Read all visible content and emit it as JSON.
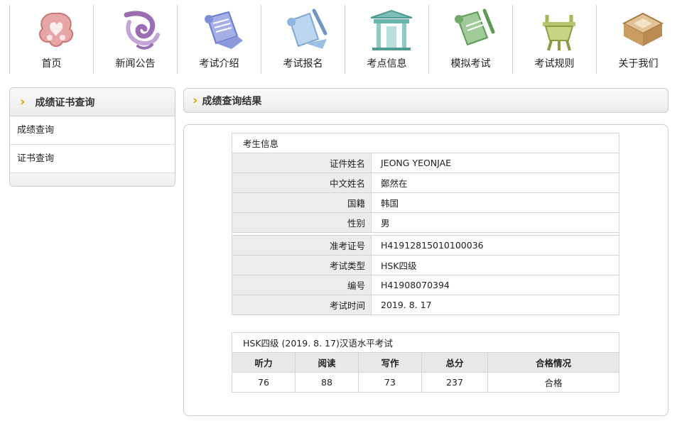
{
  "nav": [
    {
      "label": "首页",
      "icon": "home-cloud-icon",
      "color": "#d98f8f"
    },
    {
      "label": "新闻公告",
      "icon": "news-swirl-icon",
      "color": "#9a6db5"
    },
    {
      "label": "考试介绍",
      "icon": "exam-scroll-icon",
      "color": "#7f8fd6"
    },
    {
      "label": "考试报名",
      "icon": "register-scroll-icon",
      "color": "#8fb6df"
    },
    {
      "label": "考点信息",
      "icon": "test-center-gate-icon",
      "color": "#6ab5ad"
    },
    {
      "label": "模拟考试",
      "icon": "mock-exam-scroll-icon",
      "color": "#72a86a"
    },
    {
      "label": "考试规则",
      "icon": "rules-tripod-icon",
      "color": "#a4b55a"
    },
    {
      "label": "关于我们",
      "icon": "about-box-icon",
      "color": "#b98a52"
    }
  ],
  "sidebar": {
    "title": "成绩证书查询",
    "items": [
      {
        "label": "成绩查询"
      },
      {
        "label": "证书查询"
      }
    ]
  },
  "main": {
    "title": "成绩查询结果",
    "candidate": {
      "header": "考生信息",
      "rows1": [
        {
          "k": "证件姓名",
          "v": "JEONG YEONJAE"
        },
        {
          "k": "中文姓名",
          "v": "鄭然在"
        },
        {
          "k": "国籍",
          "v": "韩国"
        },
        {
          "k": "性别",
          "v": "男"
        }
      ],
      "rows2": [
        {
          "k": "准考证号",
          "v": "H41912815010100036"
        },
        {
          "k": "考试类型",
          "v": "HSK四级"
        },
        {
          "k": "编号",
          "v": "H41908070394"
        },
        {
          "k": "考试时间",
          "v": "2019. 8. 17"
        }
      ]
    },
    "score": {
      "title": "HSK四级 (2019. 8. 17)汉语水平考试",
      "headers": [
        "听力",
        "阅读",
        "写作",
        "总分",
        "合格情况"
      ],
      "values": [
        "76",
        "88",
        "73",
        "237",
        "合格"
      ]
    }
  }
}
